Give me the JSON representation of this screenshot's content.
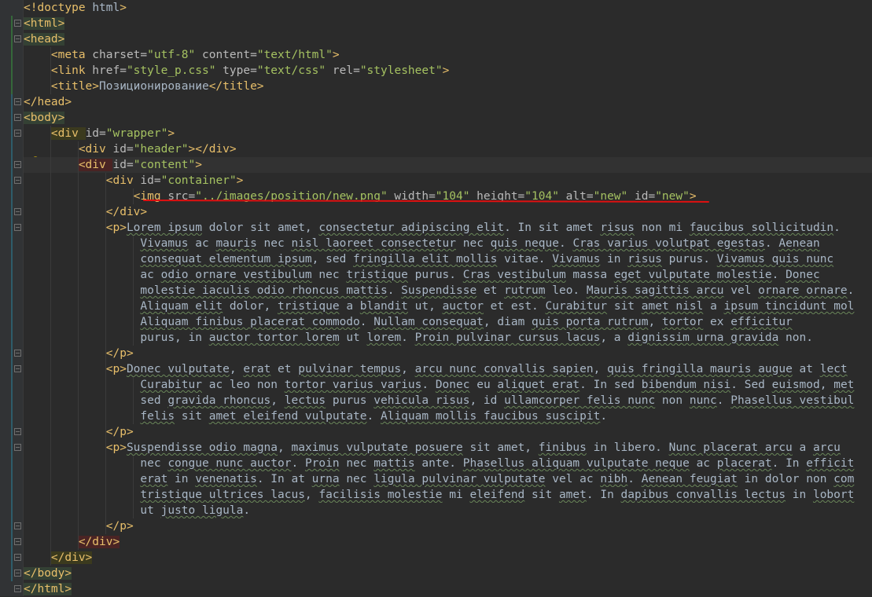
{
  "editor": {
    "language": "HTML",
    "lines": [
      {
        "indent": 0,
        "tokens": [
          [
            "tag",
            "<!doctype "
          ],
          [
            "txt",
            "html"
          ],
          [
            "tag",
            ">"
          ]
        ]
      },
      {
        "indent": 0,
        "hl": "green",
        "tokens": [
          [
            "tag",
            "<html>"
          ]
        ]
      },
      {
        "indent": 0,
        "hl": "green",
        "tokens": [
          [
            "tag",
            "<head>"
          ]
        ]
      },
      {
        "indent": 1,
        "tokens": [
          [
            "tag",
            "<meta "
          ],
          [
            "attr",
            "charset="
          ],
          [
            "val",
            "\"utf-8\""
          ],
          [
            "attr",
            " content="
          ],
          [
            "val",
            "\"text/html\""
          ],
          [
            "tag",
            ">"
          ]
        ]
      },
      {
        "indent": 1,
        "tokens": [
          [
            "tag",
            "<link "
          ],
          [
            "attr",
            "href="
          ],
          [
            "val",
            "\"style_p.css\""
          ],
          [
            "attr",
            " type="
          ],
          [
            "val",
            "\"text/css\""
          ],
          [
            "attr",
            " rel="
          ],
          [
            "val",
            "\"stylesheet\""
          ],
          [
            "tag",
            ">"
          ]
        ]
      },
      {
        "indent": 1,
        "tokens": [
          [
            "tag",
            "<title>"
          ],
          [
            "txt",
            "Позиционирование"
          ],
          [
            "tag",
            "</title>"
          ]
        ]
      },
      {
        "indent": 0,
        "tokens": [
          [
            "tag",
            "</head>"
          ]
        ]
      },
      {
        "indent": 0,
        "hl": "green",
        "tokens": [
          [
            "tag",
            "<body>"
          ]
        ]
      },
      {
        "indent": 1,
        "hl": "olive",
        "tokens": [
          [
            "tag",
            "<div "
          ],
          [
            "attr",
            "id="
          ],
          [
            "val",
            "\"wrapper\""
          ],
          [
            "tag",
            ">"
          ]
        ]
      },
      {
        "indent": 2,
        "tokens": [
          [
            "tag",
            "<div "
          ],
          [
            "attr",
            "id="
          ],
          [
            "val",
            "\"header\""
          ],
          [
            "tag",
            "></div>"
          ]
        ]
      },
      {
        "indent": 2,
        "caret": true,
        "hl": "red",
        "tokens": [
          [
            "tag",
            "<div "
          ],
          [
            "attr",
            "id="
          ],
          [
            "val",
            "\"content\""
          ],
          [
            "tag",
            ">"
          ]
        ]
      },
      {
        "indent": 3,
        "tokens": [
          [
            "tag",
            "<div "
          ],
          [
            "attr",
            "id="
          ],
          [
            "val",
            "\"container\""
          ],
          [
            "tag",
            ">"
          ]
        ]
      },
      {
        "indent": 4,
        "tokens": [
          [
            "tag",
            "<img "
          ],
          [
            "attr",
            "src="
          ],
          [
            "val",
            "\"../images/position/new.png\""
          ],
          [
            "attr",
            " width="
          ],
          [
            "val",
            "\"104\""
          ],
          [
            "attr",
            " height="
          ],
          [
            "val",
            "\"104\""
          ],
          [
            "attr",
            " alt="
          ],
          [
            "val",
            "\"new\""
          ],
          [
            "attr",
            " id="
          ],
          [
            "val",
            "\"new\""
          ],
          [
            "tag",
            ">"
          ]
        ]
      },
      {
        "indent": 3,
        "tokens": [
          [
            "tag",
            "</div>"
          ]
        ]
      },
      {
        "indent": 3,
        "tokens": [
          [
            "tag",
            "<p>"
          ],
          [
            "u",
            "Lorem ipsum"
          ],
          [
            "txt",
            " dolor sit amet, "
          ],
          [
            "u",
            "consectetur adipiscing elit"
          ],
          [
            "txt",
            ". In sit amet "
          ],
          [
            "u",
            "risus"
          ],
          [
            "txt",
            " non mi "
          ],
          [
            "u",
            "faucibus sollicitudin"
          ],
          [
            "txt",
            "."
          ]
        ]
      },
      {
        "indent": 4,
        "tail": true,
        "tokens": [
          [
            "u",
            "Vivamus"
          ],
          [
            "txt",
            " ac "
          ],
          [
            "u",
            "mauris"
          ],
          [
            "txt",
            " nec "
          ],
          [
            "u",
            "nisl laoreet consectetur"
          ],
          [
            "txt",
            " nec "
          ],
          [
            "u",
            "quis neque"
          ],
          [
            "txt",
            ". "
          ],
          [
            "u",
            "Cras varius volutpat egestas"
          ],
          [
            "txt",
            ". "
          ],
          [
            "u",
            "Aenean"
          ]
        ]
      },
      {
        "indent": 4,
        "tail": true,
        "tokens": [
          [
            "u",
            "consequat elementum ipsum"
          ],
          [
            "txt",
            ", sed "
          ],
          [
            "u",
            "fringilla elit mollis"
          ],
          [
            "txt",
            " vitae. "
          ],
          [
            "u",
            "Vivamus"
          ],
          [
            "txt",
            " in "
          ],
          [
            "u",
            "risus"
          ],
          [
            "txt",
            " purus. "
          ],
          [
            "u",
            "Vivamus quis nunc"
          ]
        ]
      },
      {
        "indent": 4,
        "tail": true,
        "tokens": [
          [
            "txt",
            "ac "
          ],
          [
            "u",
            "odio ornare vestibulum"
          ],
          [
            "txt",
            " nec "
          ],
          [
            "u",
            "tristique"
          ],
          [
            "txt",
            " purus. "
          ],
          [
            "u",
            "Cras vestibulum"
          ],
          [
            "txt",
            " massa "
          ],
          [
            "u",
            "eget vulputate molestie"
          ],
          [
            "txt",
            ". "
          ],
          [
            "u",
            "Donec"
          ]
        ]
      },
      {
        "indent": 4,
        "tail": true,
        "tokens": [
          [
            "u",
            "molestie iaculis odio rhoncus mattis"
          ],
          [
            "txt",
            ". "
          ],
          [
            "u",
            "Suspendisse"
          ],
          [
            "txt",
            " et "
          ],
          [
            "u",
            "rutrum"
          ],
          [
            "txt",
            " leo. "
          ],
          [
            "u",
            "Mauris sagittis arcu"
          ],
          [
            "txt",
            " vel "
          ],
          [
            "u",
            "ornare ornare"
          ],
          [
            "txt",
            "."
          ]
        ]
      },
      {
        "indent": 4,
        "tail": true,
        "tokens": [
          [
            "u",
            "Aliquam elit"
          ],
          [
            "txt",
            " dolor, "
          ],
          [
            "u",
            "tristique"
          ],
          [
            "txt",
            " a "
          ],
          [
            "u",
            "blandit"
          ],
          [
            "txt",
            " ut, "
          ],
          [
            "u",
            "auctor"
          ],
          [
            "txt",
            " et est. "
          ],
          [
            "u",
            "Curabitur"
          ],
          [
            "txt",
            " sit "
          ],
          [
            "u",
            "amet nisl"
          ],
          [
            "txt",
            " a "
          ],
          [
            "u",
            "ipsum tincidunt mol"
          ]
        ]
      },
      {
        "indent": 4,
        "tail": true,
        "tokens": [
          [
            "u",
            "Aliquam finibus placerat commodo"
          ],
          [
            "txt",
            ". "
          ],
          [
            "u",
            "Nullam consequat"
          ],
          [
            "txt",
            ", diam "
          ],
          [
            "u",
            "quis porta rutrum"
          ],
          [
            "txt",
            ", "
          ],
          [
            "u",
            "tortor"
          ],
          [
            "txt",
            " ex "
          ],
          [
            "u",
            "efficitur"
          ]
        ]
      },
      {
        "indent": 4,
        "tail": true,
        "tokens": [
          [
            "txt",
            "purus, in "
          ],
          [
            "u",
            "auctor tortor lorem"
          ],
          [
            "txt",
            " ut "
          ],
          [
            "u",
            "lorem"
          ],
          [
            "txt",
            ". "
          ],
          [
            "u",
            "Proin pulvinar cursus lacus"
          ],
          [
            "txt",
            ", a "
          ],
          [
            "u",
            "dignissim urna gravida"
          ],
          [
            "txt",
            " non."
          ]
        ]
      },
      {
        "indent": 3,
        "tokens": [
          [
            "tag",
            "</p>"
          ]
        ]
      },
      {
        "indent": 3,
        "tokens": [
          [
            "tag",
            "<p>"
          ],
          [
            "u",
            "Donec vulputate"
          ],
          [
            "txt",
            ", "
          ],
          [
            "u",
            "erat"
          ],
          [
            "txt",
            " et "
          ],
          [
            "u",
            "pulvinar tempus"
          ],
          [
            "txt",
            ", "
          ],
          [
            "u",
            "arcu nunc convallis sapien"
          ],
          [
            "txt",
            ", "
          ],
          [
            "u",
            "quis fringilla mauris augue"
          ],
          [
            "txt",
            " at "
          ],
          [
            "u",
            "lect"
          ]
        ]
      },
      {
        "indent": 4,
        "tail": true,
        "tokens": [
          [
            "u",
            "Curabitur"
          ],
          [
            "txt",
            " ac leo non "
          ],
          [
            "u",
            "tortor varius varius"
          ],
          [
            "txt",
            ". "
          ],
          [
            "u",
            "Donec"
          ],
          [
            "txt",
            " eu "
          ],
          [
            "u",
            "aliquet erat"
          ],
          [
            "txt",
            ". In sed "
          ],
          [
            "u",
            "bibendum nisi"
          ],
          [
            "txt",
            ". Sed "
          ],
          [
            "u",
            "euismod"
          ],
          [
            "txt",
            ", "
          ],
          [
            "u",
            "met"
          ]
        ]
      },
      {
        "indent": 4,
        "tail": true,
        "tokens": [
          [
            "txt",
            "sed "
          ],
          [
            "u",
            "gravida rhoncus"
          ],
          [
            "txt",
            ", "
          ],
          [
            "u",
            "lectus"
          ],
          [
            "txt",
            " purus "
          ],
          [
            "u",
            "vehicula risus"
          ],
          [
            "txt",
            ", id "
          ],
          [
            "u",
            "ullamcorper felis nunc"
          ],
          [
            "txt",
            " non "
          ],
          [
            "u",
            "nunc"
          ],
          [
            "txt",
            ". "
          ],
          [
            "u",
            "Phasellus vestibul"
          ]
        ]
      },
      {
        "indent": 4,
        "tail": true,
        "tokens": [
          [
            "u",
            "felis"
          ],
          [
            "txt",
            " sit "
          ],
          [
            "u",
            "amet eleifend vulputate"
          ],
          [
            "txt",
            ". "
          ],
          [
            "u",
            "Aliquam mollis faucibus suscipit"
          ],
          [
            "txt",
            "."
          ]
        ]
      },
      {
        "indent": 3,
        "tokens": [
          [
            "tag",
            "</p>"
          ]
        ]
      },
      {
        "indent": 3,
        "tokens": [
          [
            "tag",
            "<p>"
          ],
          [
            "u",
            "Suspendisse odio magna"
          ],
          [
            "txt",
            ", "
          ],
          [
            "u",
            "maximus vulputate posuere"
          ],
          [
            "txt",
            " sit amet, "
          ],
          [
            "u",
            "finibus"
          ],
          [
            "txt",
            " in libero. "
          ],
          [
            "u",
            "Nunc placerat arcu"
          ],
          [
            "txt",
            " a "
          ],
          [
            "u",
            "arcu"
          ]
        ]
      },
      {
        "indent": 4,
        "tail": true,
        "tokens": [
          [
            "txt",
            "nec "
          ],
          [
            "u",
            "congue nunc auctor"
          ],
          [
            "txt",
            ". "
          ],
          [
            "u",
            "Proin"
          ],
          [
            "txt",
            " nec "
          ],
          [
            "u",
            "mattis"
          ],
          [
            "txt",
            " ante. "
          ],
          [
            "u",
            "Phasellus aliquam vulputate neque"
          ],
          [
            "txt",
            " ac "
          ],
          [
            "u",
            "placerat"
          ],
          [
            "txt",
            ". In "
          ],
          [
            "u",
            "efficit"
          ]
        ]
      },
      {
        "indent": 4,
        "tail": true,
        "tokens": [
          [
            "u",
            "erat"
          ],
          [
            "txt",
            " in "
          ],
          [
            "u",
            "venenatis"
          ],
          [
            "txt",
            ". In at "
          ],
          [
            "u",
            "urna"
          ],
          [
            "txt",
            " nec "
          ],
          [
            "u",
            "ligula pulvinar vulputate"
          ],
          [
            "txt",
            " vel ac "
          ],
          [
            "u",
            "nibh"
          ],
          [
            "txt",
            ". "
          ],
          [
            "u",
            "Aenean feugiat"
          ],
          [
            "txt",
            " in dolor non "
          ],
          [
            "u",
            "com"
          ]
        ]
      },
      {
        "indent": 4,
        "tail": true,
        "tokens": [
          [
            "u",
            "tristique ultrices lacus"
          ],
          [
            "txt",
            ", "
          ],
          [
            "u",
            "facilisis molestie"
          ],
          [
            "txt",
            " mi "
          ],
          [
            "u",
            "eleifend"
          ],
          [
            "txt",
            " sit "
          ],
          [
            "u",
            "amet"
          ],
          [
            "txt",
            ". In "
          ],
          [
            "u",
            "dapibus convallis lectus"
          ],
          [
            "txt",
            " in "
          ],
          [
            "u",
            "lobort"
          ]
        ]
      },
      {
        "indent": 4,
        "tail": true,
        "tokens": [
          [
            "txt",
            "ut "
          ],
          [
            "u",
            "justo ligula"
          ],
          [
            "txt",
            "."
          ]
        ]
      },
      {
        "indent": 3,
        "tokens": [
          [
            "tag",
            "</p>"
          ]
        ]
      },
      {
        "indent": 2,
        "hl": "red",
        "tokens": [
          [
            "tag",
            "</div>"
          ]
        ]
      },
      {
        "indent": 1,
        "hl": "olive",
        "tokens": [
          [
            "tag",
            "</div>"
          ]
        ]
      },
      {
        "indent": 0,
        "hl": "green",
        "tokens": [
          [
            "tag",
            "</body>"
          ]
        ]
      },
      {
        "indent": 0,
        "hl": "green",
        "tokens": [
          [
            "tag",
            "</html>"
          ]
        ]
      }
    ]
  },
  "colors": {
    "background": "#2b2b2b",
    "tag": "#e8bf6a",
    "attribute": "#bababa",
    "value": "#a5c261",
    "text": "#a9b7c6",
    "annotation_underline": "#e01010"
  },
  "icons": [
    "intention-bulb-icon"
  ]
}
